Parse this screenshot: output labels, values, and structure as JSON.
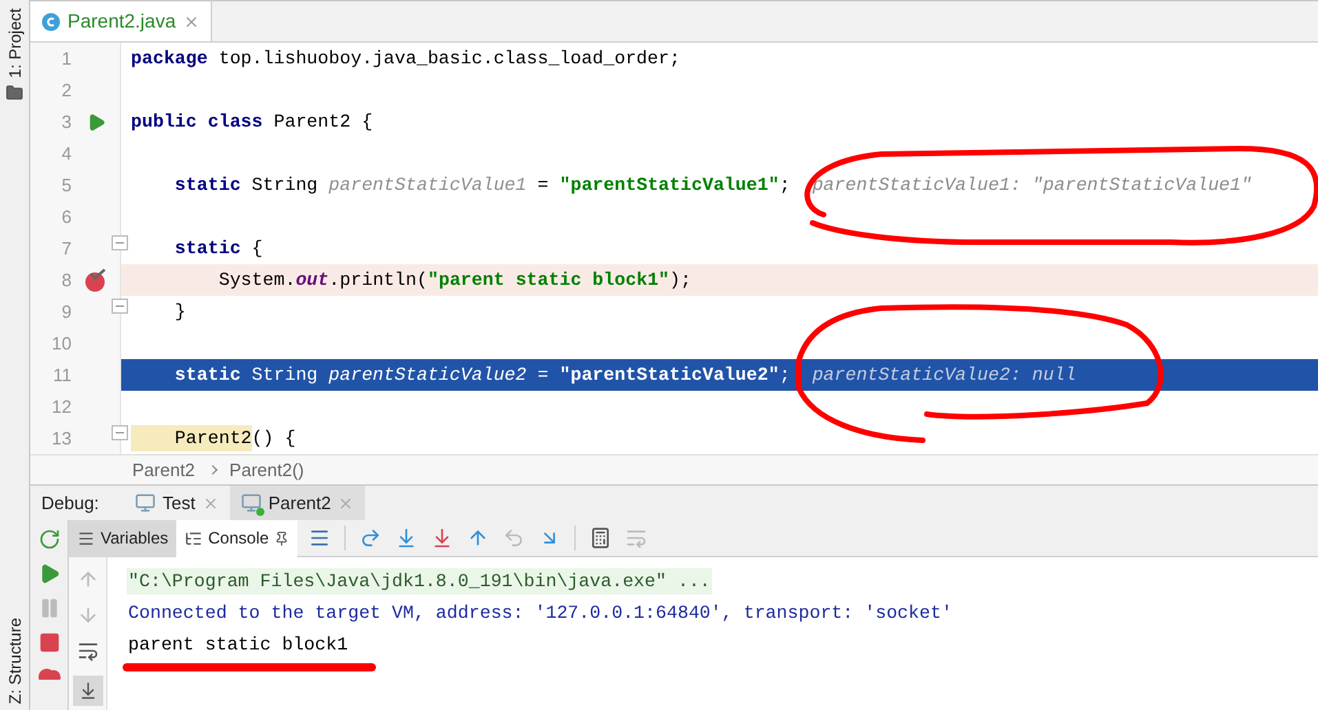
{
  "sidebar": {
    "top_tab": "1: Project",
    "bottom_tab": "Z: Structure"
  },
  "editor_tabs": [
    {
      "label": "Parent2.java",
      "selected": true
    }
  ],
  "code_lines": [
    {
      "number": "1",
      "runnable": false,
      "breakpoint": false,
      "execution_point": false,
      "foldable": false,
      "tokens": [
        {
          "kind": "keyword",
          "text": "package"
        },
        {
          "kind": "plain",
          "text": " top.lishuoboy.java_basic.class_load_order;"
        }
      ]
    },
    {
      "number": "2",
      "runnable": false,
      "breakpoint": false,
      "execution_point": false,
      "foldable": false
    },
    {
      "number": "3",
      "runnable": true,
      "breakpoint": false,
      "execution_point": false,
      "foldable": false,
      "tokens": [
        {
          "kind": "keyword",
          "text": "public class"
        },
        {
          "kind": "plain",
          "text": " Parent2 {"
        }
      ]
    },
    {
      "number": "4",
      "runnable": false,
      "breakpoint": false,
      "execution_point": false,
      "foldable": false
    },
    {
      "number": "5",
      "runnable": false,
      "breakpoint": false,
      "execution_point": false,
      "foldable": false,
      "tokens": [
        {
          "kind": "keyword",
          "text": "    static"
        },
        {
          "kind": "plain",
          "text": " String "
        },
        {
          "kind": "static_field",
          "text": "parentStaticValue1"
        },
        {
          "kind": "plain",
          "text": " = "
        },
        {
          "kind": "string",
          "text": "\"parentStaticValue1\""
        },
        {
          "kind": "plain",
          "text": ";"
        },
        {
          "kind": "hint",
          "text": "parentStaticValue1: \"parentStaticValue1\""
        }
      ]
    },
    {
      "number": "6",
      "runnable": false,
      "breakpoint": false,
      "execution_point": false,
      "foldable": false
    },
    {
      "number": "7",
      "runnable": false,
      "breakpoint": false,
      "execution_point": false,
      "foldable": true,
      "tokens": [
        {
          "kind": "keyword",
          "text": "    static"
        },
        {
          "kind": "plain",
          "text": " {"
        }
      ]
    },
    {
      "number": "8",
      "runnable": false,
      "breakpoint": true,
      "execution_point": false,
      "foldable": false,
      "tokens": [
        {
          "kind": "plain",
          "text": "        System."
        },
        {
          "kind": "field",
          "text": "out"
        },
        {
          "kind": "plain",
          "text": ".println("
        },
        {
          "kind": "string",
          "text": "\"parent static block1\""
        },
        {
          "kind": "plain",
          "text": ");"
        }
      ]
    },
    {
      "number": "9",
      "runnable": false,
      "breakpoint": false,
      "execution_point": false,
      "foldable": true,
      "tokens": [
        {
          "kind": "plain",
          "text": "    }"
        }
      ]
    },
    {
      "number": "10",
      "runnable": false,
      "breakpoint": false,
      "execution_point": false,
      "foldable": false
    },
    {
      "number": "11",
      "runnable": false,
      "breakpoint": false,
      "execution_point": true,
      "foldable": false,
      "tokens": [
        {
          "kind": "keyword",
          "text": "    static"
        },
        {
          "kind": "plain",
          "text": " String "
        },
        {
          "kind": "static_field",
          "text": "parentStaticValue2"
        },
        {
          "kind": "plain",
          "text": " = "
        },
        {
          "kind": "string",
          "text": "\"parentStaticValue2\""
        },
        {
          "kind": "plain",
          "text": ";"
        },
        {
          "kind": "hint",
          "text": "parentStaticValue2: null"
        }
      ]
    },
    {
      "number": "12",
      "runnable": false,
      "breakpoint": false,
      "execution_point": false,
      "foldable": false
    },
    {
      "number": "13",
      "runnable": false,
      "breakpoint": false,
      "execution_point": false,
      "foldable": true,
      "tokens": [
        {
          "kind": "usage",
          "text": "    Parent2"
        },
        {
          "kind": "plain",
          "text": "() {"
        }
      ]
    }
  ],
  "breadcrumbs": [
    "Parent2",
    "Parent2()"
  ],
  "debug": {
    "label": "Debug:",
    "sessions": [
      {
        "label": "Test",
        "selected": false,
        "running": false
      },
      {
        "label": "Parent2",
        "selected": true,
        "running": true
      }
    ],
    "panel_tabs": [
      {
        "label": "Variables",
        "selected": false
      },
      {
        "label": "Console",
        "selected": true
      }
    ]
  },
  "console_lines": [
    {
      "kind": "command",
      "text": "\"C:\\Program Files\\Java\\jdk1.8.0_191\\bin\\java.exe\" ..."
    },
    {
      "kind": "info",
      "text": "Connected to the target VM, address: '127.0.0.1:64840', transport: 'socket'"
    },
    {
      "kind": "output",
      "text": "parent static block1"
    }
  ]
}
